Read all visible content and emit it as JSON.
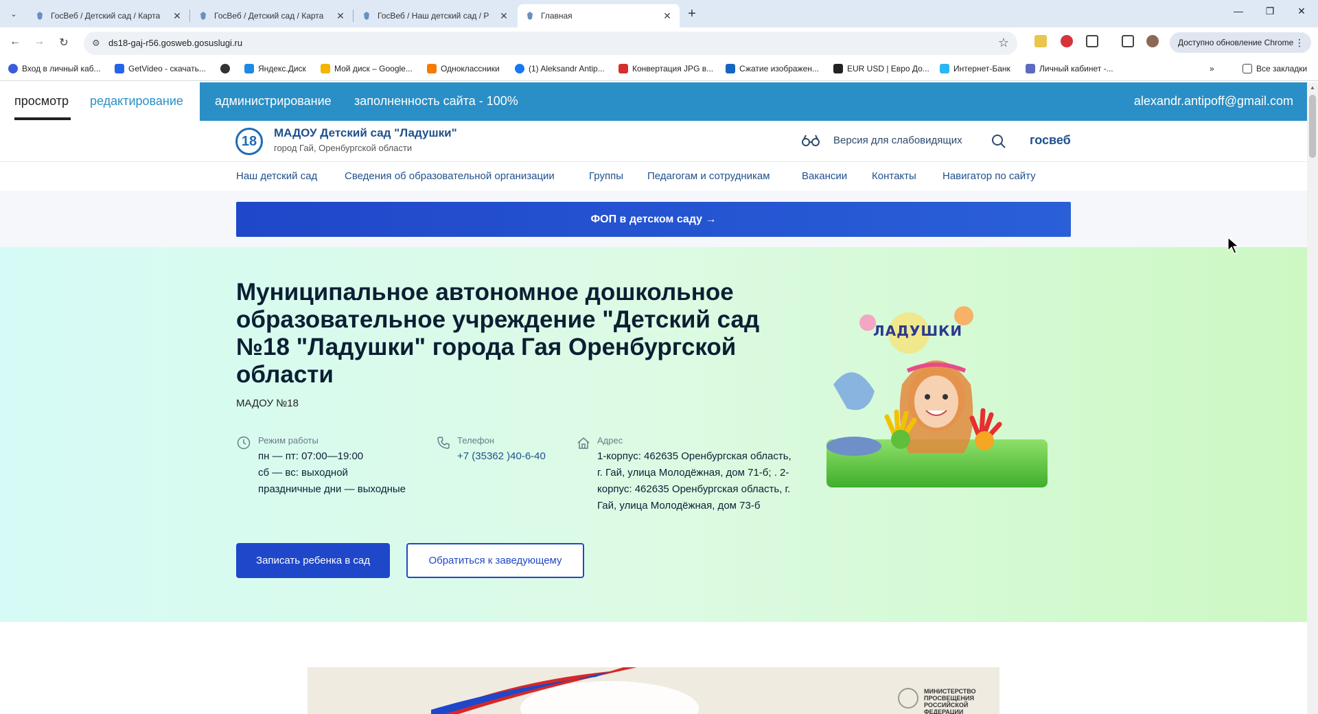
{
  "browser": {
    "tabs": [
      {
        "title": "ГосВеб / Детский сад / Карта",
        "active": false
      },
      {
        "title": "ГосВеб / Детский сад / Карта",
        "active": false
      },
      {
        "title": "ГосВеб / Наш детский сад / Р",
        "active": false
      },
      {
        "title": "Главная",
        "active": true
      }
    ],
    "url": "ds18-gaj-r56.gosweb.gosuslugi.ru",
    "update_label": "Доступно обновление Chrome",
    "bookmarks": [
      {
        "label": "Вход в личный каб...",
        "color": "#3b5bdb"
      },
      {
        "label": "GetVideo - скачать...",
        "color": "#2563eb"
      },
      {
        "label": "",
        "color": "#333333"
      },
      {
        "label": "Яндекс.Диск",
        "color": "#1e88e5"
      },
      {
        "label": "Мой диск – Google...",
        "color": "#f4b400"
      },
      {
        "label": "Одноклассники",
        "color": "#f57c00"
      },
      {
        "label": "(1) Aleksandr Antip...",
        "color": "#1877f2"
      },
      {
        "label": "Конвертация JPG в...",
        "color": "#d32f2f"
      },
      {
        "label": "Сжатие изображен...",
        "color": "#1565c0"
      },
      {
        "label": "EUR USD | Евро До...",
        "color": "#222222"
      },
      {
        "label": "Интернет-Банк",
        "color": "#29b6f6"
      },
      {
        "label": "Личный кабинет -...",
        "color": "#5c6bc0"
      }
    ],
    "all_bookmarks": "Все закладки"
  },
  "admin": {
    "view": "просмотр",
    "edit": "редактирование",
    "admin": "администрирование",
    "fill": "заполненность сайта - 100%",
    "email": "alexandr.antipoff@gmail.com"
  },
  "site": {
    "logo_number": "18",
    "org_name": "МАДОУ Детский сад \"Ладушки\"",
    "org_city": "город Гай, Оренбургской области",
    "vision_label": "Версия для слабовидящих",
    "brand": "госвеб"
  },
  "nav": [
    "Наш детский сад",
    "Сведения об образовательной организации",
    "Группы",
    "Педагогам и сотрудникам",
    "Вакансии",
    "Контакты",
    "Навигатор по сайту"
  ],
  "fop_banner": "ФОП в детском саду →",
  "hero": {
    "title": "Муниципальное автономное дошкольное образовательное учреждение \"Детский сад №18 \"Ладушки\" города Гая Оренбургской области",
    "short": "МАДОУ №18",
    "hours_label": "Режим работы",
    "hours": [
      "пн — пт: 07:00—19:00",
      "сб — вс: выходной",
      "праздничные дни — выходные"
    ],
    "phone_label": "Телефон",
    "phone": "+7 (35362 )40-6-40",
    "address_label": "Адрес",
    "address": [
      "1-корпус: 462635 Оренбургская область,",
      "г. Гай, улица Молодёжная, дом 71-б; . 2-",
      "корпус: 462635 Оренбургская область, г.",
      "Гай, улица Молодёжная, дом 73-б"
    ],
    "image_caption": "ЛАДУШКИ",
    "btn_enroll": "Записать ребенка в сад",
    "btn_contact": "Обратиться к заведующему"
  },
  "ministry": {
    "text": "МИНИСТЕРСТВО ПРОСВЕЩЕНИЯ РОССИЙСКОЙ ФЕДЕРАЦИИ"
  },
  "colors": {
    "admin_bar": "#2a8fc6",
    "primary": "#1f47c9",
    "link": "#1f4f8c"
  }
}
